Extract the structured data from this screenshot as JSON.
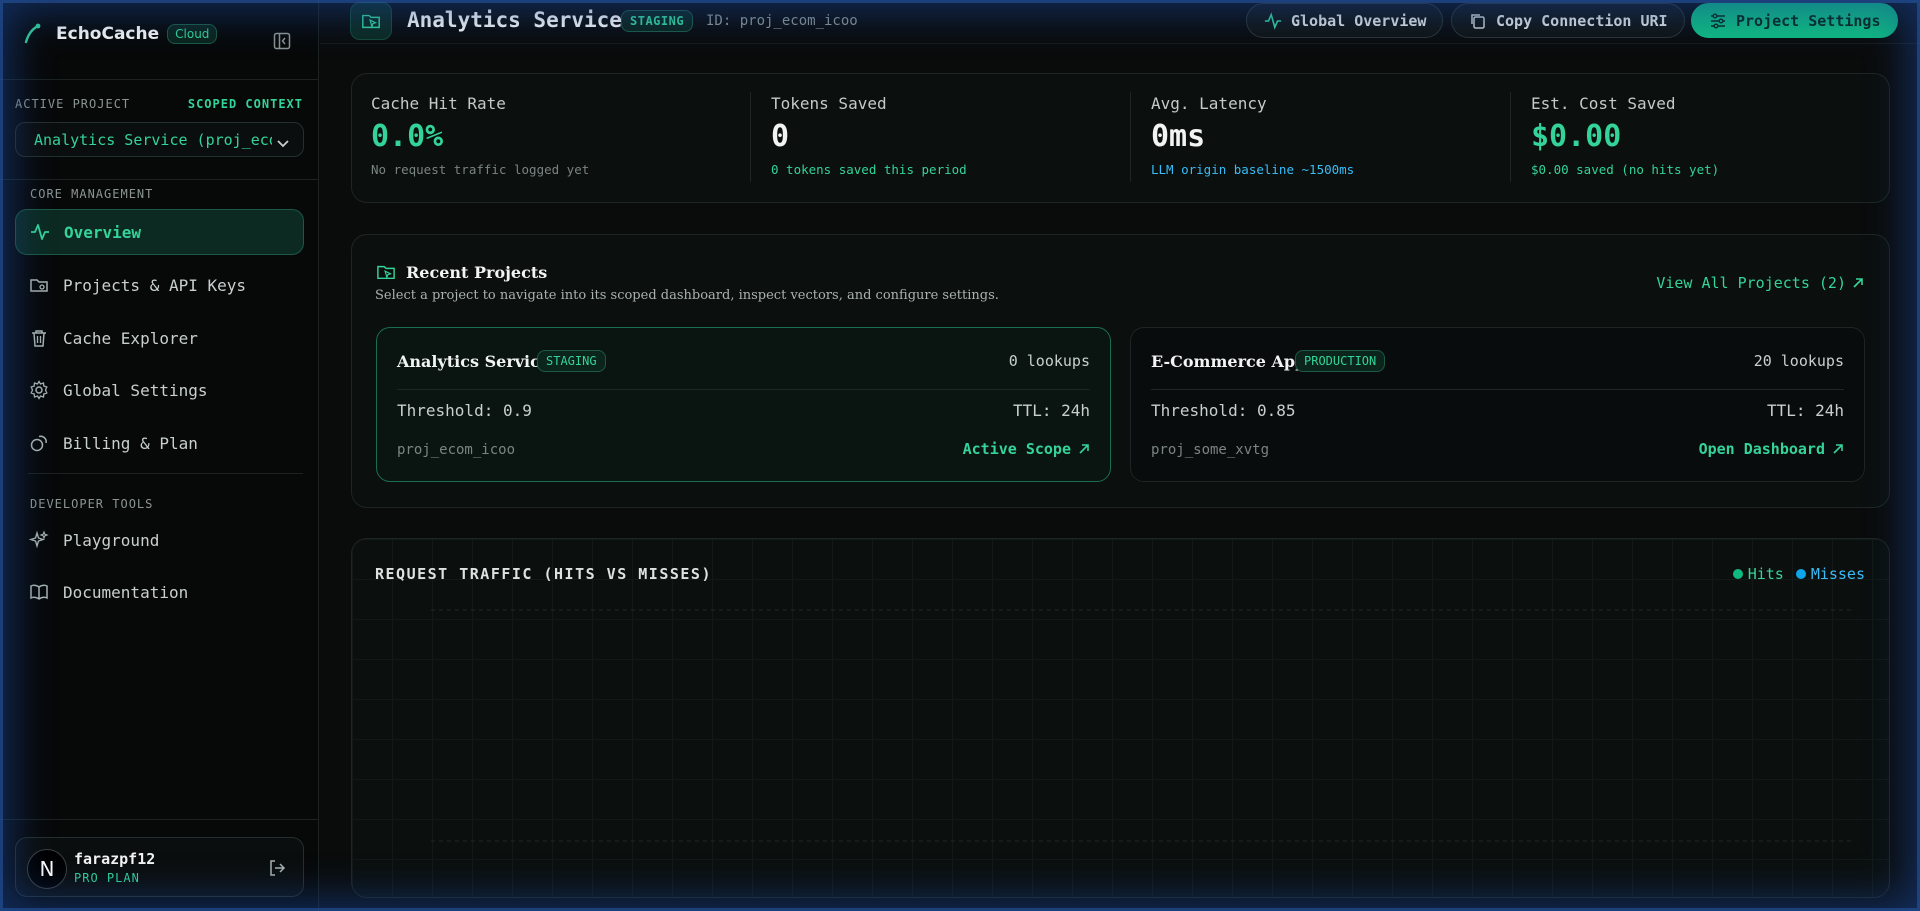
{
  "app": {
    "name": "EchoCache",
    "badge": "Cloud"
  },
  "sidebar": {
    "active_project_label": "ACTIVE PROJECT",
    "scoped_label": "SCOPED CONTEXT",
    "project_select": "Analytics Service (proj_ecom_icoo)",
    "core_label": "CORE MANAGEMENT",
    "dev_label": "DEVELOPER TOOLS",
    "items": [
      {
        "label": "Overview",
        "icon": "activity-icon"
      },
      {
        "label": "Projects & API Keys",
        "icon": "folder-key-icon"
      },
      {
        "label": "Cache Explorer",
        "icon": "trash-icon"
      },
      {
        "label": "Global Settings",
        "icon": "gear-icon"
      },
      {
        "label": "Billing & Plan",
        "icon": "coins-icon"
      }
    ],
    "dev_items": [
      {
        "label": "Playground",
        "icon": "sparkles-icon"
      },
      {
        "label": "Documentation",
        "icon": "book-icon"
      }
    ],
    "user": {
      "avatar": "N",
      "name": "farazpf12",
      "plan": "PRO PLAN"
    }
  },
  "header": {
    "title": "Analytics Service",
    "env": "STAGING",
    "id_text": "ID: proj_ecom_icoo",
    "buttons": {
      "overview": "Global Overview",
      "copy": "Copy Connection URI",
      "settings": "Project Settings"
    }
  },
  "stats": [
    {
      "title": "Cache Hit Rate",
      "value": "0.0%",
      "sub": "No request traffic logged yet"
    },
    {
      "title": "Tokens Saved",
      "value": "0",
      "sub": "0 tokens saved this period"
    },
    {
      "title": "Avg. Latency",
      "value": "0ms",
      "sub": "LLM origin baseline ~1500ms"
    },
    {
      "title": "Est. Cost Saved",
      "value": "$0.00",
      "sub": "$0.00 saved (no hits yet)"
    }
  ],
  "recent": {
    "title": "Recent Projects",
    "subtitle": "Select a project to navigate into its scoped dashboard, inspect vectors, and configure settings.",
    "view_all": "View All Projects (2)",
    "projects": [
      {
        "name": "Analytics Service",
        "env": "STAGING",
        "lookups": "0 lookups",
        "threshold": "Threshold: 0.9",
        "ttl": "TTL: 24h",
        "id": "proj_ecom_icoo",
        "action": "Active Scope"
      },
      {
        "name": "E-Commerce App",
        "env": "PRODUCTION",
        "lookups": "20 lookups",
        "threshold": "Threshold: 0.85",
        "ttl": "TTL: 24h",
        "id": "proj_some_xvtg",
        "action": "Open Dashboard"
      }
    ]
  },
  "traffic": {
    "title": "REQUEST TRAFFIC (HITS VS MISSES)",
    "legend": [
      {
        "label": "Hits",
        "color": "#10b981"
      },
      {
        "label": "Misses",
        "color": "#0ea5e9"
      }
    ]
  },
  "colors": {
    "accent": "#34d399",
    "accent_strong": "#10b981",
    "info": "#38bdf8"
  }
}
